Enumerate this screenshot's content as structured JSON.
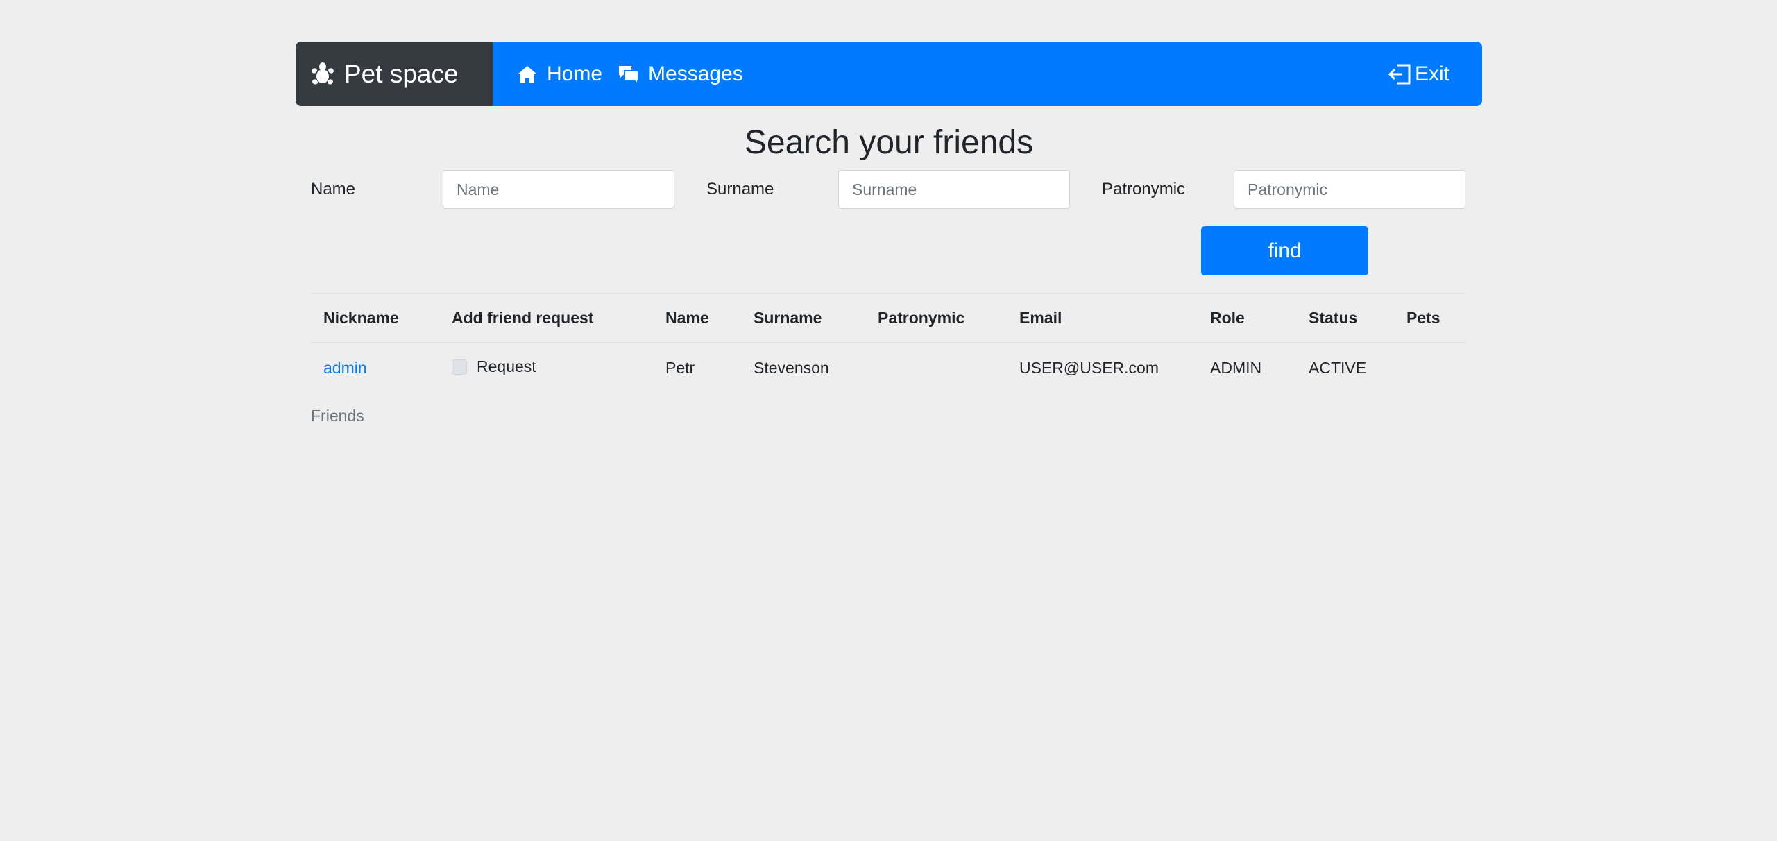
{
  "navbar": {
    "brand": "Pet space",
    "brand_icon": "paw-icon",
    "links": [
      {
        "label": "Home",
        "icon": "home-icon"
      },
      {
        "label": "Messages",
        "icon": "messages-icon"
      }
    ],
    "exit_label": "Exit",
    "exit_icon": "exit-icon",
    "colors": {
      "navbar": "#007bff",
      "brand_bg": "#343a40"
    }
  },
  "page_title": "Search your friends",
  "search": {
    "name_label": "Name",
    "name_placeholder": "Name",
    "surname_label": "Surname",
    "surname_placeholder": "Surname",
    "patronymic_label": "Patronymic",
    "patronymic_placeholder": "Patronymic",
    "find_label": "find"
  },
  "table": {
    "headers": [
      "Nickname",
      "Add friend request",
      "Name",
      "Surname",
      "Patronymic",
      "Email",
      "Role",
      "Status",
      "Pets"
    ],
    "rows": [
      {
        "nickname": "admin",
        "request_label": "Request",
        "request_checked": false,
        "name": "Petr",
        "surname": "Stevenson",
        "patronymic": "",
        "email": "USER@USER.com",
        "role": "ADMIN",
        "status": "ACTIVE",
        "pets": ""
      }
    ]
  },
  "friends_label": "Friends"
}
